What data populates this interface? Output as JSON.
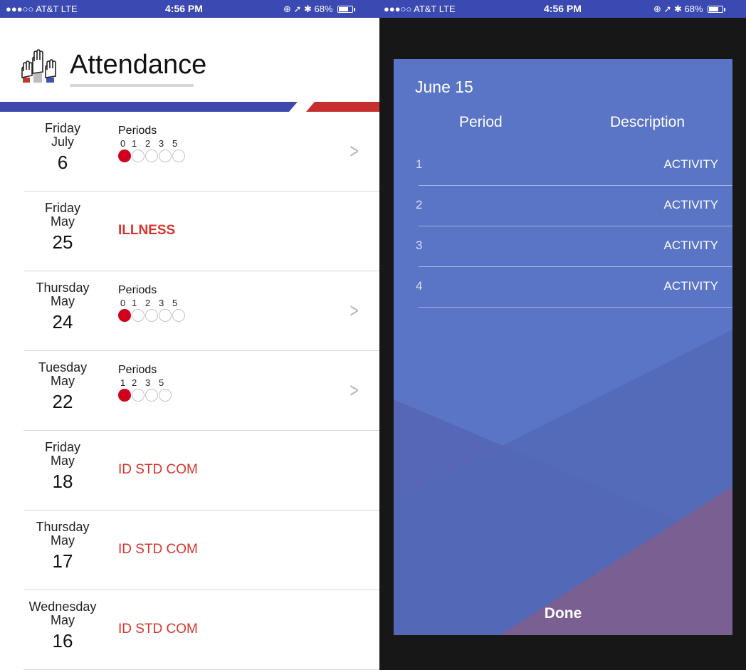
{
  "left": {
    "statusbar": {
      "carrier": "●●●○○ AT&T  LTE",
      "time": "4:56 PM",
      "right": "⊕ ➚ ✱ 68%"
    },
    "title": "Attendance",
    "periods_label": "Periods",
    "rows": [
      {
        "dow": "Friday",
        "month": "July",
        "day": "6",
        "type": "periods",
        "periods": [
          "0",
          "1",
          "2",
          "3",
          "5"
        ],
        "filled_count": 1
      },
      {
        "dow": "Friday",
        "month": "May",
        "day": "25",
        "type": "status",
        "status": "ILLNESS"
      },
      {
        "dow": "Thursday",
        "month": "May",
        "day": "24",
        "type": "periods",
        "periods": [
          "0",
          "1",
          "2",
          "3",
          "5"
        ],
        "filled_count": 1
      },
      {
        "dow": "Tuesday",
        "month": "May",
        "day": "22",
        "type": "periods",
        "periods": [
          "1",
          "2",
          "3",
          "5"
        ],
        "filled_count": 1
      },
      {
        "dow": "Friday",
        "month": "May",
        "day": "18",
        "type": "status",
        "status": "ID STD COM"
      },
      {
        "dow": "Thursday",
        "month": "May",
        "day": "17",
        "type": "status",
        "status": "ID STD COM"
      },
      {
        "dow": "Wednesday",
        "month": "May",
        "day": "16",
        "type": "status",
        "status": "ID STD COM"
      }
    ]
  },
  "right": {
    "statusbar": {
      "carrier": "●●●○○ AT&T  LTE",
      "time": "4:56 PM",
      "right": "⊕ ➚ ✱ 68%"
    },
    "modal": {
      "date": "June 15",
      "col_period": "Period",
      "col_description": "Description",
      "rows": [
        {
          "period": "1",
          "description": "ACTIVITY"
        },
        {
          "period": "2",
          "description": "ACTIVITY"
        },
        {
          "period": "3",
          "description": "ACTIVITY"
        },
        {
          "period": "4",
          "description": "ACTIVITY"
        }
      ],
      "done_label": "Done"
    }
  },
  "colors": {
    "statusbar": "#3b49b2",
    "absent": "#d0021b",
    "status_text": "#d8342c",
    "modal_bg": "#5a74c6"
  },
  "icons": {
    "logo": "raised-hands-icon",
    "chevron": "chevron-right-icon",
    "battery": "battery-icon"
  }
}
